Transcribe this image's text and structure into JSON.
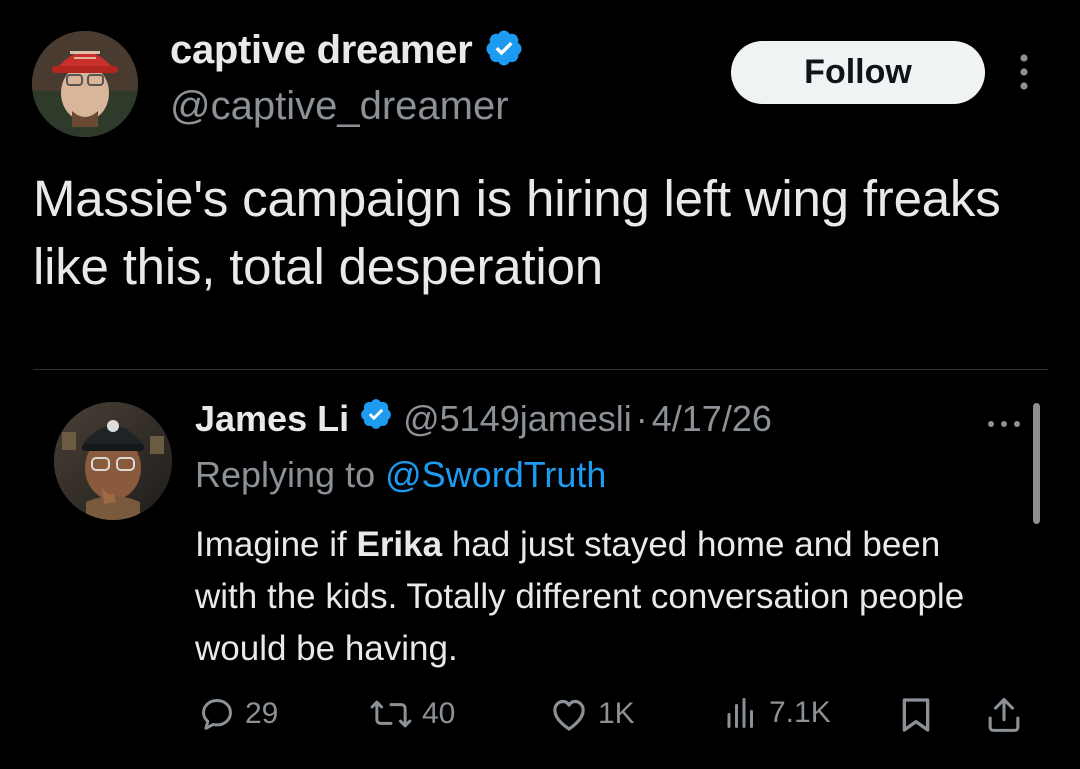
{
  "tweet": {
    "author": {
      "display_name": "captive dreamer",
      "handle": "@captive_dreamer",
      "verified": true,
      "avatar": "avatar-red-hat"
    },
    "follow_label": "Follow",
    "more_icon": "more-vertical-icon",
    "text": "Massie's campaign is hiring left wing freaks like this, total desperation"
  },
  "quoted": {
    "author": {
      "display_name": "James Li",
      "handle": "@5149jamesli",
      "verified": true,
      "avatar": "avatar-glasses-cap"
    },
    "separator": "·",
    "date": "4/17/26",
    "replying_prefix": "Replying to",
    "replying_to": "@SwordTruth",
    "text_before": "Imagine if ",
    "text_bold": "Erika",
    "text_after": " had just stayed home and been with the kids. Totally different conversation people would be having.",
    "more_icon": "more-horizontal-icon",
    "actions": {
      "replies": "29",
      "reposts": "40",
      "likes": "1K",
      "views": "7.1K"
    }
  },
  "colors": {
    "background": "#000000",
    "text": "#e7e9ea",
    "muted": "#8b9196",
    "accent": "#1d9bf0",
    "follow_bg": "#eff3f4"
  }
}
